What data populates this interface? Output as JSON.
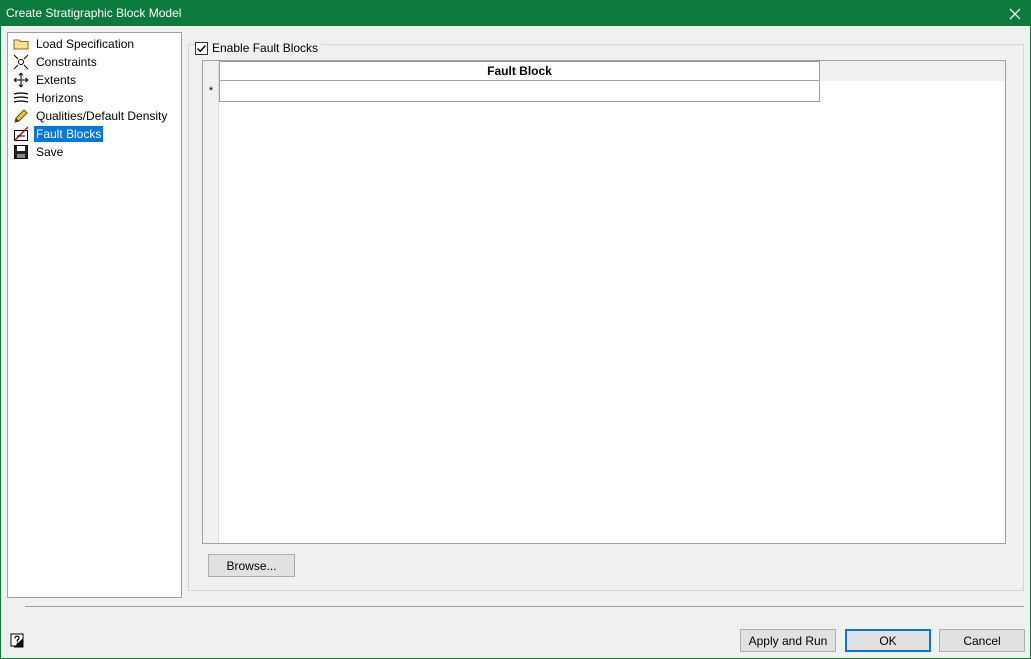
{
  "window": {
    "title": "Create Stratigraphic Block Model"
  },
  "tree": {
    "items": [
      {
        "label": "Load Specification",
        "icon": "folder-icon"
      },
      {
        "label": "Constraints",
        "icon": "constraints-icon"
      },
      {
        "label": "Extents",
        "icon": "move-arrows-icon"
      },
      {
        "label": "Horizons",
        "icon": "horizons-icon"
      },
      {
        "label": "Qualities/Default Density",
        "icon": "pencil-icon"
      },
      {
        "label": "Fault Blocks",
        "icon": "fault-icon",
        "selected": true
      },
      {
        "label": "Save",
        "icon": "floppy-disk-icon"
      }
    ]
  },
  "fault_panel": {
    "enable_label": "Enable Fault Blocks",
    "enable_checked": true,
    "column_header": "Fault Block",
    "new_row_marker": "*",
    "browse_label": "Browse..."
  },
  "footer": {
    "apply_label": "Apply and Run",
    "ok_label": "OK",
    "cancel_label": "Cancel"
  },
  "colors": {
    "titlebar": "#0b7a3a",
    "selection": "#0078d7"
  }
}
